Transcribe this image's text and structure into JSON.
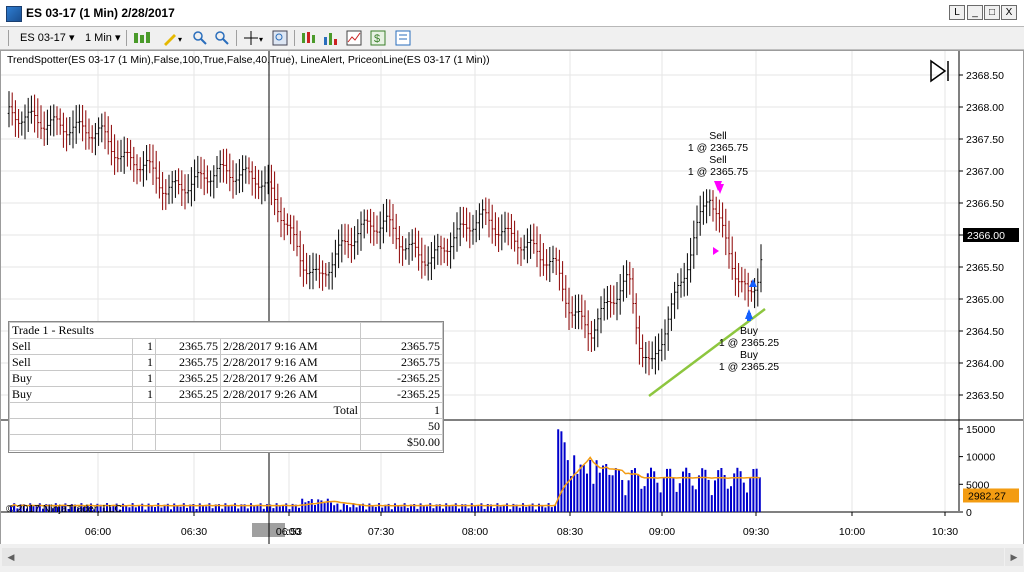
{
  "window": {
    "title": "ES 03-17 (1 Min)  2/28/2017",
    "btn_l": "L",
    "btn_min": "_",
    "btn_max": "□",
    "btn_close": "X"
  },
  "toolbar": {
    "instrument": "ES 03-17",
    "interval": "1 Min"
  },
  "indicator_label": "TrendSpotter(ES 03-17 (1 Min),False,100,True,False,40,True), LineAlert, PriceonLine(ES 03-17 (1 Min))",
  "price_axis": [
    "2368.50",
    "2368.00",
    "2367.50",
    "2367.00",
    "2366.50",
    "2366.00",
    "2365.50",
    "2365.00",
    "2364.50",
    "2364.00",
    "2363.50"
  ],
  "current_price": "2366.00",
  "volume_axis": [
    "15000",
    "10000",
    "5000",
    "0"
  ],
  "current_volume": "2982.27",
  "time_axis": [
    "06:00",
    "06:30",
    "06:53",
    "07:30",
    "08:00",
    "08:30",
    "09:00",
    "09:30",
    "10:00",
    "10:30"
  ],
  "crosshair_time_fragment": ":00",
  "copyright": "© 2017 NinjaTrader, LLC",
  "annotations": [
    {
      "side": "Sell",
      "detail": "1 @ 2365.75"
    },
    {
      "side": "Sell",
      "detail": "1 @ 2365.75"
    },
    {
      "side": "Buy",
      "detail": "1 @ 2365.25"
    },
    {
      "side": "Buy",
      "detail": "1 @ 2365.25"
    }
  ],
  "results": {
    "title": "Trade 1 - Results",
    "rows": [
      {
        "side": "Sell",
        "qty": "1",
        "price": "2365.75",
        "time": "2/28/2017 9:16    AM",
        "value": "2365.75"
      },
      {
        "side": "Sell",
        "qty": "1",
        "price": "2365.75",
        "time": "2/28/2017 9:16 AM",
        "value": "2365.75"
      },
      {
        "side": "Buy",
        "qty": "1",
        "price": "2365.25",
        "time": "2/28/2017 9:26 AM",
        "value": "-2365.25"
      },
      {
        "side": "Buy",
        "qty": "1",
        "price": "2365.25",
        "time": "2/28/2017 9:26 AM",
        "value": "-2365.25"
      }
    ],
    "total_label": "Total",
    "total_count": "1",
    "points": "50",
    "dollars": "$50.00"
  },
  "colors": {
    "up_bar": "#000000",
    "down_bar": "#8b0000",
    "volume": "#0000cc",
    "trend_line": "#8dc63f",
    "sell_marker": "#ff00ff",
    "buy_marker": "#1560ff"
  }
}
